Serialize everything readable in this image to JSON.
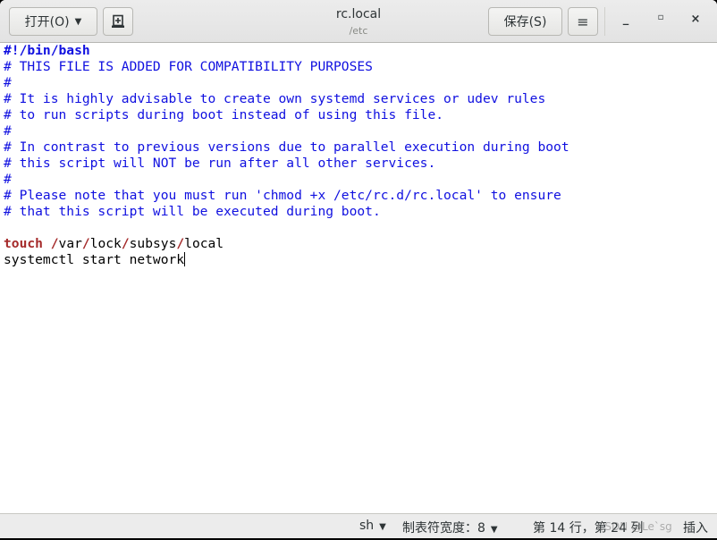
{
  "header": {
    "open_label": "打开(O)",
    "title": "rc.local",
    "subtitle": "/etc",
    "save_label": "保存(S)"
  },
  "editor": {
    "shebang": "#!/bin/bash",
    "comments": [
      "# THIS FILE IS ADDED FOR COMPATIBILITY PURPOSES",
      "#",
      "# It is highly advisable to create own systemd services or udev rules",
      "# to run scripts during boot instead of using this file.",
      "#",
      "# In contrast to previous versions due to parallel execution during boot",
      "# this script will NOT be run after all other services.",
      "#",
      "# Please note that you must run 'chmod +x /etc/rc.d/rc.local' to ensure",
      "# that this script will be executed during boot."
    ],
    "touch_cmd": "touch",
    "touch_path": [
      "var",
      "lock",
      "subsys",
      "local"
    ],
    "slash": "/",
    "last_line": "systemctl start network"
  },
  "status": {
    "language": "sh",
    "tab_width": "制表符宽度：8",
    "position": "第 14 行，第 24 列",
    "mode": "插入",
    "watermark": "CSDN @Le`sg"
  }
}
